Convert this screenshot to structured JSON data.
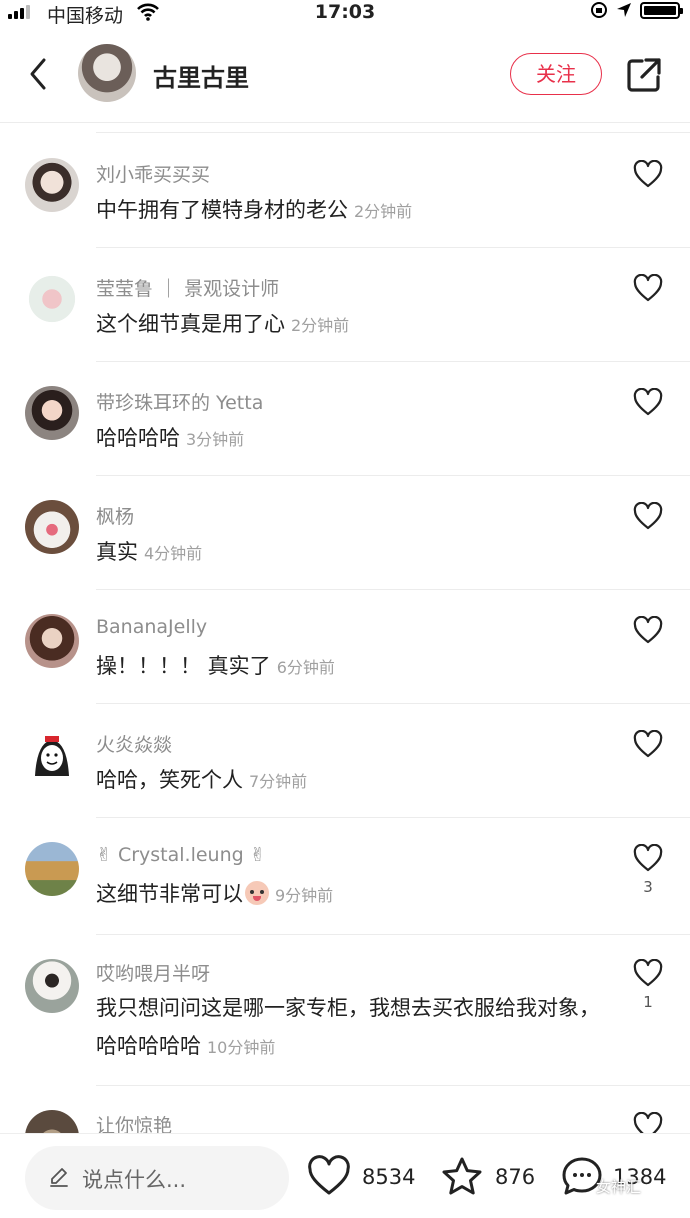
{
  "status_bar": {
    "carrier": "中国移动",
    "time": "17:03"
  },
  "header": {
    "title": "古里古里",
    "follow_label": "关注"
  },
  "comments": [
    {
      "name": "刘小乖买买买",
      "text": "中午拥有了模特身材的老公",
      "time": "2分钟前",
      "likes": ""
    },
    {
      "name": "莹莹鲁 ｜ 景观设计师",
      "text": "这个细节真是用了心",
      "time": "2分钟前",
      "likes": ""
    },
    {
      "name": "带珍珠耳环的 Yetta",
      "text": "哈哈哈哈",
      "time": "3分钟前",
      "likes": ""
    },
    {
      "name": "枫杨",
      "text": "真实",
      "time": "4分钟前",
      "likes": ""
    },
    {
      "name": "BananaJelly",
      "text": "操！！！！ 真实了",
      "time": "6分钟前",
      "likes": ""
    },
    {
      "name": "火炎焱燚",
      "text": "哈哈，笑死个人",
      "time": "7分钟前",
      "likes": ""
    },
    {
      "name": "✌ Crystal.leung ✌",
      "text": "这细节非常可以",
      "time": "9分钟前",
      "likes": "3"
    },
    {
      "name": "哎哟喂月半呀",
      "text": "我只想问问这是哪一家专柜，我想去买衣服给我对象，哈哈哈哈哈",
      "time": "10分钟前",
      "likes": "1"
    },
    {
      "name": "让你惊艳",
      "text": "",
      "time": "",
      "likes": ""
    }
  ],
  "bottom_bar": {
    "input_placeholder": "说点什么...",
    "like_count": "8534",
    "star_count": "876",
    "comment_count": "1384",
    "watermark": "女神汇"
  },
  "colors": {
    "accent": "#e8304a",
    "secondary_text": "#8d8d8d",
    "divider": "#ececec"
  }
}
